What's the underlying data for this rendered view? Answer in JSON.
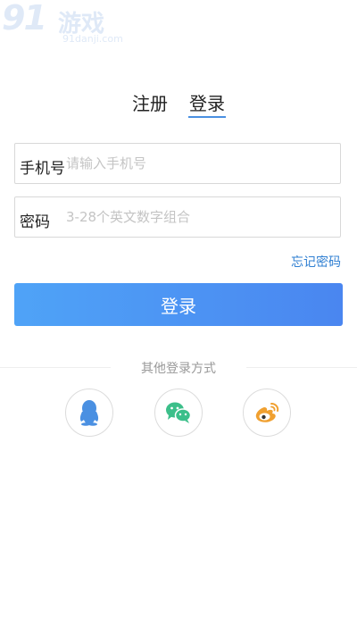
{
  "watermark": {
    "logo_number": "91",
    "logo_text": "游戏",
    "domain": "91danji.com"
  },
  "tabs": [
    {
      "label": "注册",
      "active": false
    },
    {
      "label": "登录",
      "active": true
    }
  ],
  "form": {
    "phone_label": "手机号",
    "phone_placeholder": "请输入手机号",
    "password_label": "密码",
    "password_placeholder": "3-28个英文数字组合",
    "forgot_label": "忘记密码",
    "submit_label": "登录"
  },
  "other_login": {
    "title": "其他登录方式",
    "methods": [
      {
        "icon": "qq-icon",
        "color": "#4a90e2"
      },
      {
        "icon": "wechat-icon",
        "color": "#3cbf8a"
      },
      {
        "icon": "weibo-icon",
        "color": "#f0a030"
      }
    ]
  },
  "colors": {
    "accent": "#4a90e2",
    "link": "#2f7fd2",
    "button_start": "#4fa3f7",
    "button_end": "#4a86f0"
  }
}
